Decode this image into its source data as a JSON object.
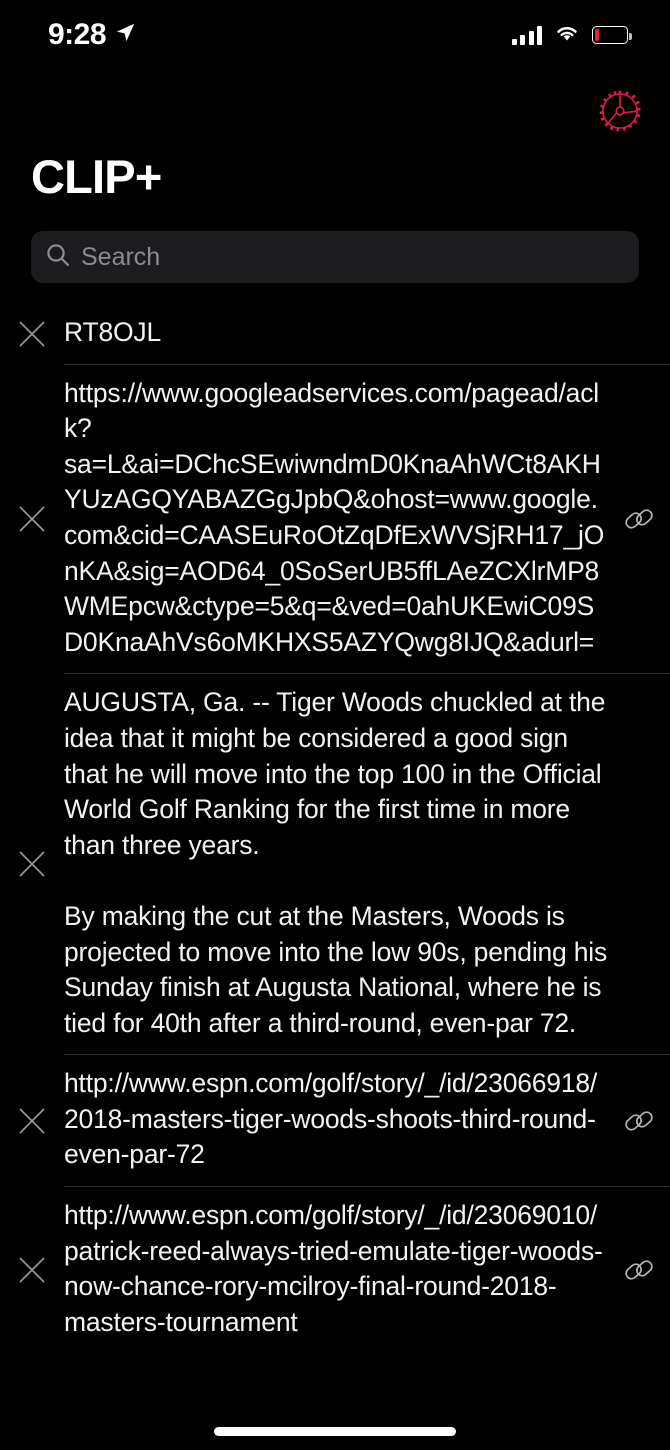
{
  "status_bar": {
    "time": "9:28",
    "location_icon": "location-arrow-icon",
    "signal_icon": "cellular-signal-icon",
    "wifi_icon": "wifi-icon",
    "battery_icon": "battery-low-icon",
    "battery_color": "#e8203f"
  },
  "header": {
    "title": "CLIP+",
    "gear_icon": "gear-icon",
    "gear_color": "#e0194f"
  },
  "search": {
    "placeholder": "Search",
    "value": "",
    "icon": "search-icon"
  },
  "icons": {
    "delete": "close-icon",
    "link": "link-chain-icon"
  },
  "list": {
    "items": [
      {
        "id": "item-1",
        "type": "text",
        "text": "RT8OJL",
        "has_link_icon": false
      },
      {
        "id": "item-2",
        "type": "url",
        "text": "https://www.googleadservices.com/pagead/aclk?sa=L&ai=DChcSEwiwndmD0KnaAhWCt8AKHYUzAGQYABAZGgJpbQ&ohost=www.google.com&cid=CAASEuRoOtZqDfExWVSjRH17_jOnKA&sig=AOD64_0SoSerUB5ffLAeZCXlrMP8WMEpcw&ctype=5&q=&ved=0ahUKEwiC09SD0KnaAhVs6oMKHXS5AZYQwg8IJQ&adurl=",
        "has_link_icon": true
      },
      {
        "id": "item-3",
        "type": "text",
        "text": "AUGUSTA, Ga. -- Tiger Woods chuckled at the idea that it might be considered a good sign that he will move into the top 100 in the Official World Golf Ranking for the first time in more than three years.\n\nBy making the cut at the Masters, Woods is projected to move into the low 90s, pending his Sunday finish at Augusta National, where he is tied for 40th after a third-round, even-par 72.",
        "has_link_icon": false
      },
      {
        "id": "item-4",
        "type": "url",
        "text": "http://www.espn.com/golf/story/_/id/23066918/2018-masters-tiger-woods-shoots-third-round-even-par-72",
        "has_link_icon": true
      },
      {
        "id": "item-5",
        "type": "url",
        "text": "http://www.espn.com/golf/story/_/id/23069010/patrick-reed-always-tried-emulate-tiger-woods-now-chance-rory-mcilroy-final-round-2018-masters-tournament",
        "has_link_icon": true
      }
    ]
  },
  "home_indicator": "home-indicator"
}
